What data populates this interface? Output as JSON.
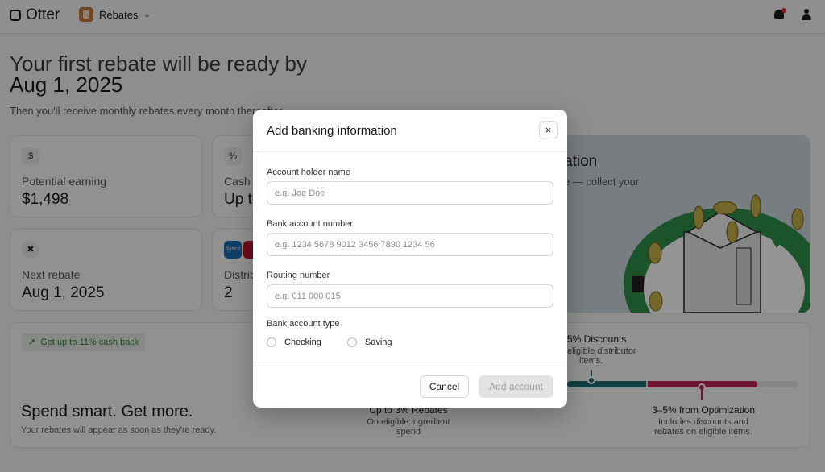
{
  "topbar": {
    "app_name": "Otter",
    "org_name": "Rebates"
  },
  "hero": {
    "line1": "Your first rebate will be ready by",
    "date": "Aug 1, 2025",
    "subtitle": "Then you'll receive monthly rebates every month thereafter."
  },
  "cards": {
    "potential": {
      "icon": "$",
      "label": "Potential earning",
      "value": "$1,498"
    },
    "cash": {
      "icon": "%",
      "label": "Cash",
      "value": "Up to"
    },
    "next": {
      "label": "Next rebate",
      "value": "Aug 1, 2025"
    },
    "distributors": {
      "label": "Distrib",
      "value": "2",
      "logo1": "Sysco"
    }
  },
  "promo": {
    "title": "ation",
    "subtitle": "e — collect your"
  },
  "bottom": {
    "badge": "Get up to 11% cash back",
    "title": "Spend smart. Get more.",
    "subtitle": "Your rebates will appear as soon as they're ready.",
    "seg1_title": "Up to 3% Rebates",
    "seg1_sub1": "On eligible ingredient",
    "seg1_sub2": "spend",
    "seg2_title": "5% Discounts",
    "seg2_sub1": "eligible distributor",
    "seg2_sub2": "items.",
    "seg3_title": "3–5% from Optimization",
    "seg3_sub1": "Includes discounts and",
    "seg3_sub2": "rebates on eligible items."
  },
  "modal": {
    "title": "Add banking information",
    "close_icon": "×",
    "account_holder_label": "Account holder name",
    "account_holder_placeholder": "e.g. Joe Doe",
    "bank_account_label": "Bank account number",
    "bank_account_placeholder": "e.g. 1234 5678 9012 3456 7890 1234 56",
    "routing_label": "Routing number",
    "routing_placeholder": "e.g. 011 000 015",
    "account_type_label": "Bank account type",
    "account_types": [
      "Checking",
      "Saving"
    ],
    "cancel_label": "Cancel",
    "add_label": "Add account"
  },
  "colors": {
    "teal": "#1f6f73",
    "crimson": "#c4245a",
    "green": "#2e7d32"
  }
}
